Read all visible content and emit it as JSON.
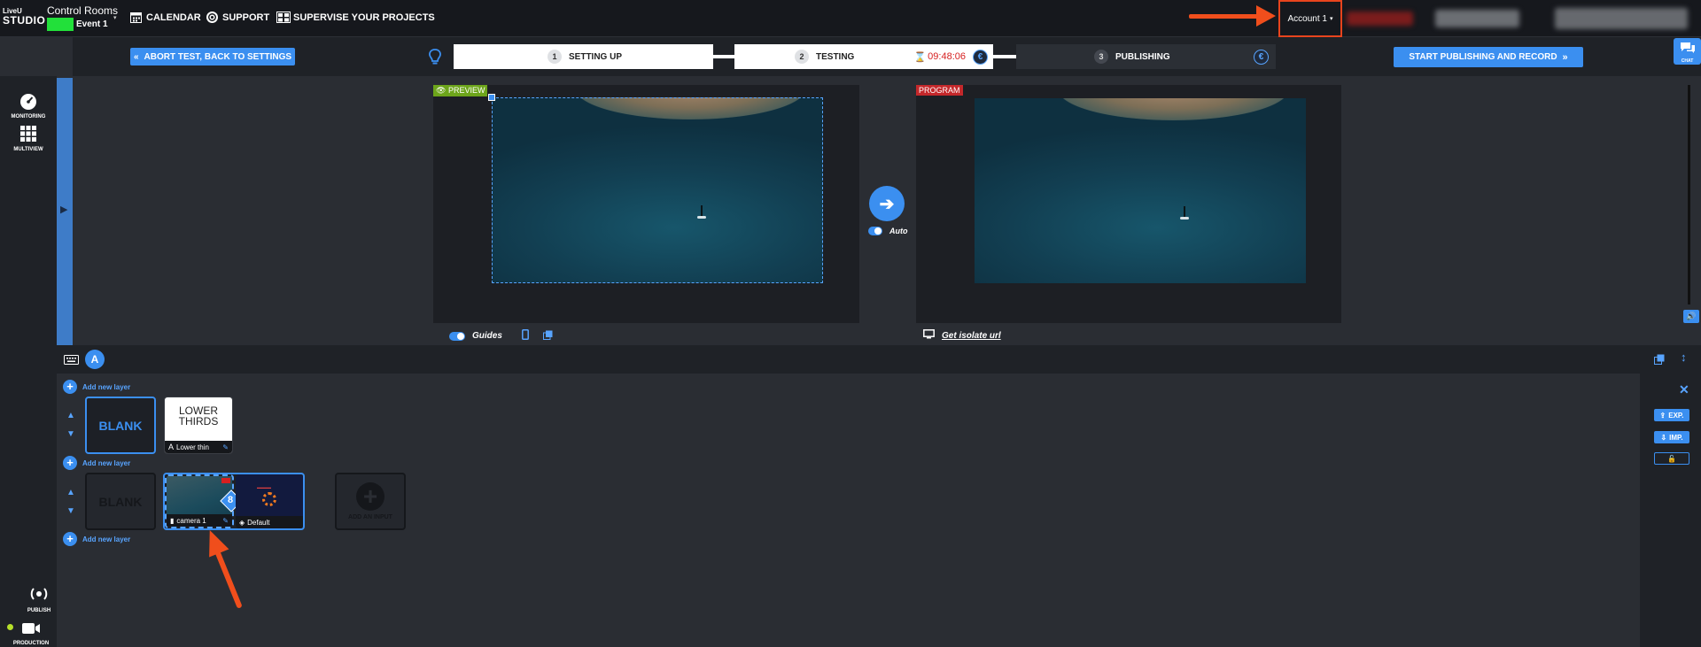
{
  "topbar": {
    "logo_line1": "LiveU",
    "logo_line2": "STUDIO",
    "room_title": "Control Rooms",
    "event_name": "Event 1",
    "nav": [
      {
        "label": "CALENDAR",
        "icon": "calendar-icon"
      },
      {
        "label": "SUPPORT",
        "icon": "support-icon"
      },
      {
        "label": "SUPERVISE YOUR PROJECTS",
        "icon": "grid-icon"
      }
    ],
    "account": "Account 1"
  },
  "steps": {
    "abort_label": "ABORT TEST, BACK TO SETTINGS",
    "items": [
      {
        "num": "1",
        "label": "SETTING UP"
      },
      {
        "num": "2",
        "label": "TESTING"
      },
      {
        "num": "3",
        "label": "PUBLISHING"
      }
    ],
    "timer": "09:48:06",
    "currency_symbol": "€",
    "start_label": "START PUBLISHING AND RECORD"
  },
  "rail": {
    "monitoring": "MONITORING",
    "multiview": "MULTIVIEW",
    "publish": "PUBLISH",
    "production": "PRODUCTION",
    "chat": "CHAT"
  },
  "preview": {
    "label": "PREVIEW",
    "guides_label": "Guides",
    "auto_label": "Auto"
  },
  "program": {
    "label": "PROGRAM",
    "isolate_label": "Get isolate url"
  },
  "layers": {
    "tab_letter": "A",
    "add_layer_label": "Add new layer",
    "blank_label": "BLANK",
    "lower_thirds_title_1": "LOWER",
    "lower_thirds_title_2": "THIRDS",
    "lower_thirds_caption": "Lower thin",
    "camera_caption": "camera 1",
    "default_caption": "Default",
    "badge_number": "8",
    "add_input_label": "ADD AN INPUT"
  },
  "side": {
    "exp": "EXP.",
    "imp": "IMP."
  },
  "colors": {
    "accent": "#3b8ff0",
    "event_green": "#22e03a",
    "annotation_orange": "#f04e1c",
    "preview_green": "#6da51b",
    "program_red": "#c4282b",
    "timer_red": "#d62020"
  }
}
